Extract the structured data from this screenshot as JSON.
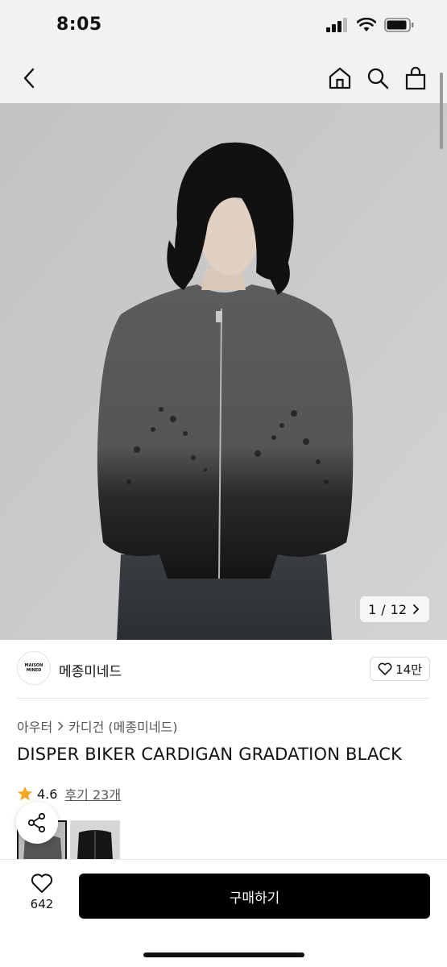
{
  "status_bar": {
    "time": "8:05"
  },
  "header": {
    "back_icon": "chevron-left-icon",
    "home_icon": "home-icon",
    "search_icon": "search-icon",
    "cart_icon": "shopping-bag-icon"
  },
  "gallery": {
    "current": "1",
    "separator": "/",
    "total": "12"
  },
  "brand": {
    "logo_text": "MAISON MINED",
    "name": "메종미네드",
    "likes": "14만"
  },
  "breadcrumb": {
    "category": "아우터",
    "subcategory": "카디건 (메종미네드)"
  },
  "product": {
    "title": "DISPER BIKER CARDIGAN GRADATION BLACK"
  },
  "rating": {
    "score": "4.6",
    "reviews": "후기 23개"
  },
  "bottom": {
    "wish_count": "642",
    "buy_label": "구매하기"
  },
  "colors": {
    "accent_star": "#f5a623",
    "buy_button": "#000000",
    "hero_bg": "#c9c9c9"
  }
}
